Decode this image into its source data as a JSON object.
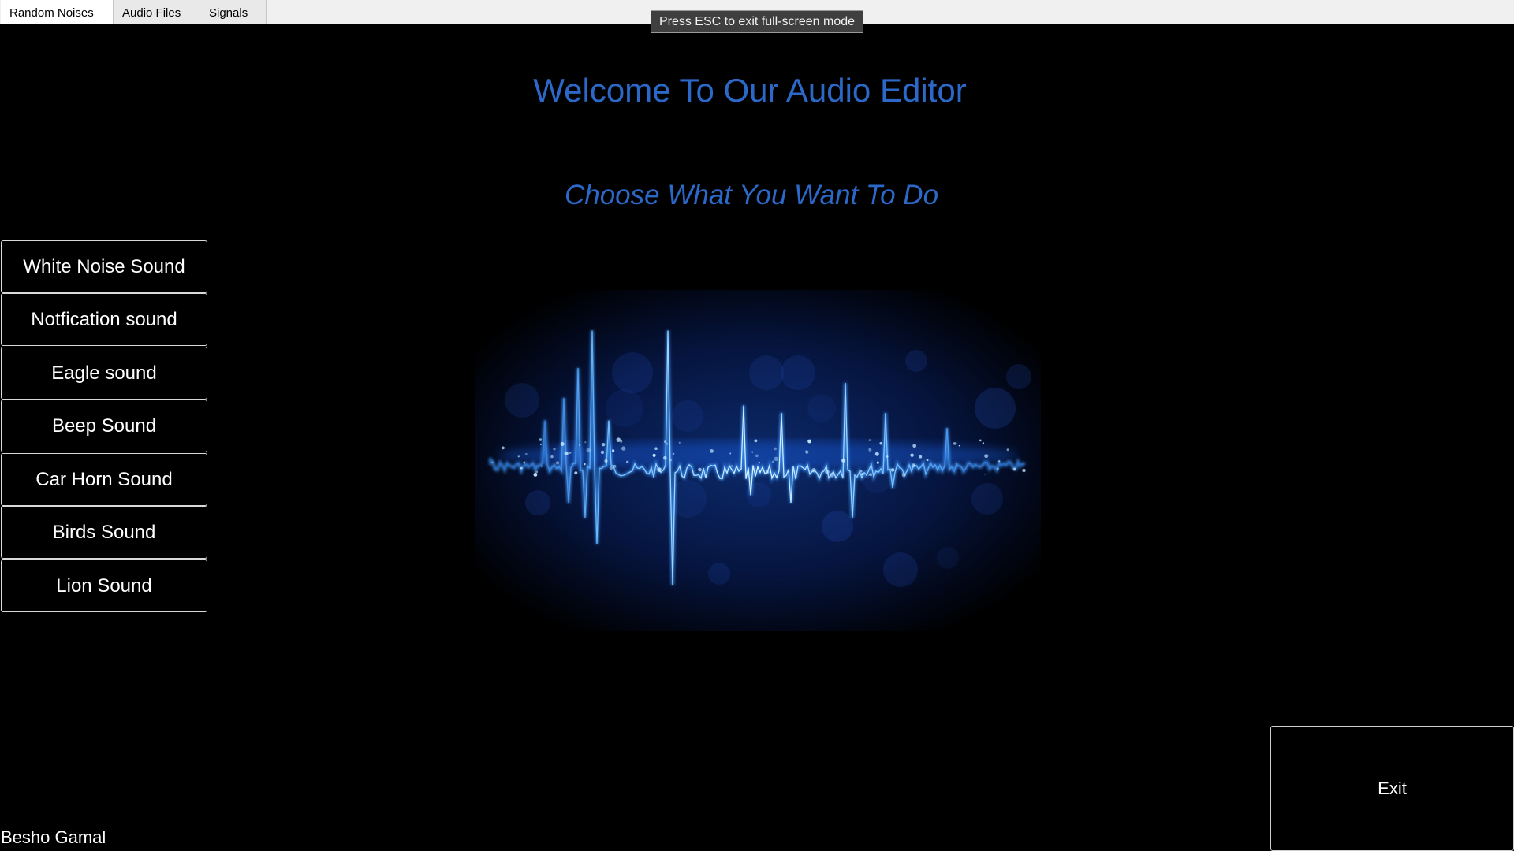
{
  "tabs": [
    {
      "label": "Random Noises"
    },
    {
      "label": "Audio Files"
    },
    {
      "label": "Signals"
    }
  ],
  "esc_notice": "Press ESC to exit full-screen mode",
  "main": {
    "welcome": "Welcome To Our Audio Editor",
    "choose": "Choose What You Want To Do",
    "sound_buttons": [
      {
        "label": "White Noise Sound"
      },
      {
        "label": "Notfication sound"
      },
      {
        "label": "Eagle sound"
      },
      {
        "label": "Beep Sound"
      },
      {
        "label": "Car Horn Sound"
      },
      {
        "label": "Birds Sound"
      },
      {
        "label": "Lion Sound"
      }
    ],
    "exit_label": "Exit",
    "author": "Besho Gamal"
  },
  "colors": {
    "background": "#000000",
    "heading_blue": "#2b68c8",
    "wave_glow": "#8fd3ff"
  }
}
